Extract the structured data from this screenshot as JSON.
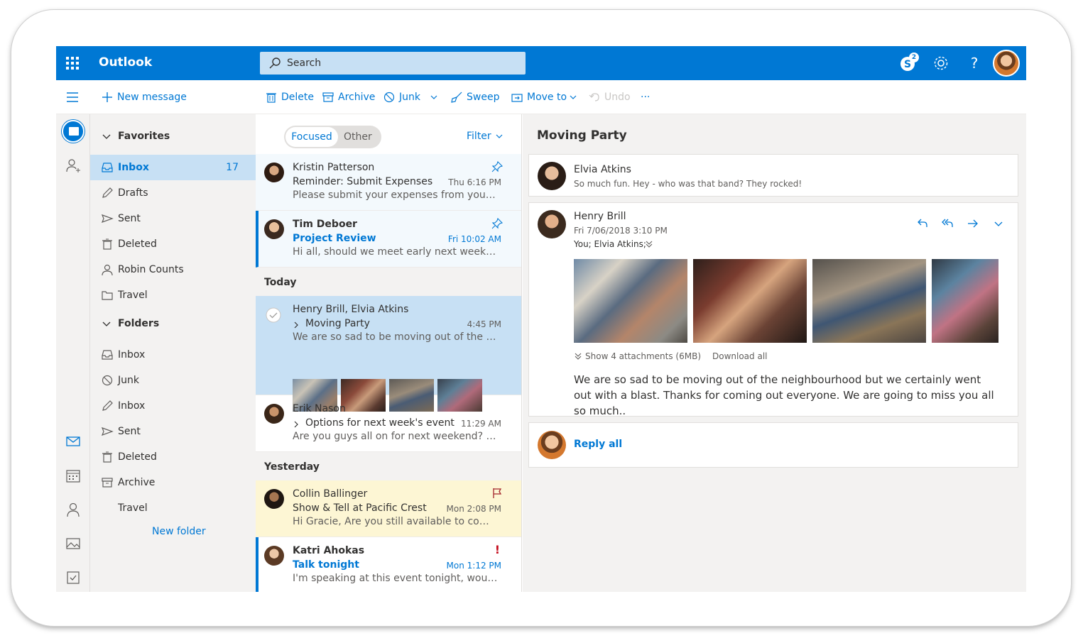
{
  "app": {
    "name": "Outlook",
    "accent": "#0078d4"
  },
  "search": {
    "placeholder": "Search"
  },
  "topbar": {
    "skype_badge": "2"
  },
  "commands": {
    "new_message": "New message",
    "delete": "Delete",
    "archive": "Archive",
    "junk": "Junk",
    "sweep": "Sweep",
    "move_to": "Move to",
    "undo": "Undo",
    "more": "···"
  },
  "folders": {
    "favorites_label": "Favorites",
    "favorites": [
      {
        "label": "Inbox",
        "count": "17",
        "icon": "inbox-icon",
        "selected": true
      },
      {
        "label": "Drafts",
        "icon": "pencil-icon"
      },
      {
        "label": "Sent",
        "icon": "send-icon"
      },
      {
        "label": "Deleted",
        "icon": "trash-icon"
      },
      {
        "label": "Robin Counts",
        "icon": "person-icon"
      },
      {
        "label": "Travel",
        "icon": "folder-icon"
      }
    ],
    "folders_label": "Folders",
    "items": [
      {
        "label": "Inbox",
        "icon": "inbox-icon"
      },
      {
        "label": "Junk",
        "icon": "blocked-icon"
      },
      {
        "label": "Inbox",
        "icon": "pencil-icon"
      },
      {
        "label": "Sent",
        "icon": "send-icon"
      },
      {
        "label": "Deleted",
        "icon": "trash-icon"
      },
      {
        "label": "Archive",
        "icon": "archive-icon"
      },
      {
        "label": "Travel",
        "icon": ""
      }
    ],
    "new_folder": "New folder"
  },
  "list": {
    "tabs": {
      "focused": "Focused",
      "other": "Other"
    },
    "filter": "Filter",
    "pinned": [
      {
        "from": "Kristin Patterson",
        "subject": "Reminder: Submit Expenses",
        "time": "Thu 6:16 PM",
        "preview": "Please submit your expenses from your last…"
      },
      {
        "from": "Tim Deboer",
        "subject": "Project Review",
        "time": "Fri 10:02 AM",
        "preview": "Hi all, should we meet early next week to di…"
      }
    ],
    "sections": {
      "today": "Today",
      "yesterday": "Yesterday"
    },
    "today": [
      {
        "from": "Henry Brill, Elvia Atkins",
        "subject": "Moving Party",
        "time": "4:45 PM",
        "preview": "We are so sad to be moving out of the nei…"
      },
      {
        "from": "Erik Nason",
        "subject": "Options for next week's event",
        "time": "11:29 AM",
        "preview": "Are you guys all on for next weekend? I was…"
      }
    ],
    "yesterday": [
      {
        "from": "Collin Ballinger",
        "subject": "Show & Tell at Pacific Crest",
        "time": "Mon 2:08 PM",
        "preview": "Hi Gracie, Are you still available to come nex…"
      },
      {
        "from": "Katri Ahokas",
        "subject": "Talk tonight",
        "time": "Mon 1:12 PM",
        "preview": "I'm speaking at this event tonight, would you…",
        "importance": "!"
      }
    ]
  },
  "reading": {
    "title": "Moving Party",
    "collapsed": {
      "from": "Elvia Atkins",
      "preview": "So much fun. Hey - who was that band? They rocked!"
    },
    "message": {
      "from": "Henry Brill",
      "date": "Fri 7/06/2018 3:10 PM",
      "to": "You; Elvia Atkins;",
      "attachments_label": "Show 4 attachments (6MB)",
      "download_all": "Download all",
      "body": "We are so sad to be moving out of the neighbourhood but we certainly went out with a blast. Thanks for coming out everyone. We are going to miss you all so much.."
    },
    "reply_all": "Reply all"
  }
}
